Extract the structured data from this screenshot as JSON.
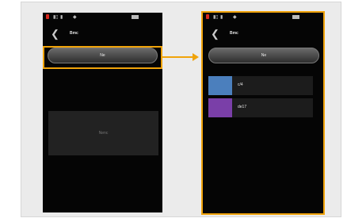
{
  "left_screen": {
    "status_bar": {
      "icons": [
        "sim-alert-icon",
        "signal-icon",
        "data-icon",
        "wifi-icon",
        "battery-icon"
      ]
    },
    "title": "Bmc",
    "button_label": "Ne",
    "empty_text": "Nenc"
  },
  "right_screen": {
    "status_bar": {
      "icons": [
        "sim-alert-icon",
        "signal-icon",
        "data-icon",
        "wifi-icon",
        "battery-icon"
      ]
    },
    "title": "Bmc",
    "button_label": "Ne",
    "items": [
      {
        "label": "c/4",
        "color": "#4b7fbd"
      },
      {
        "label": "de17",
        "color": "#7a3fa8"
      }
    ]
  },
  "colors": {
    "highlight": "#f0a30a",
    "screen_bg": "#050505",
    "panel_bg": "#ebebeb"
  }
}
